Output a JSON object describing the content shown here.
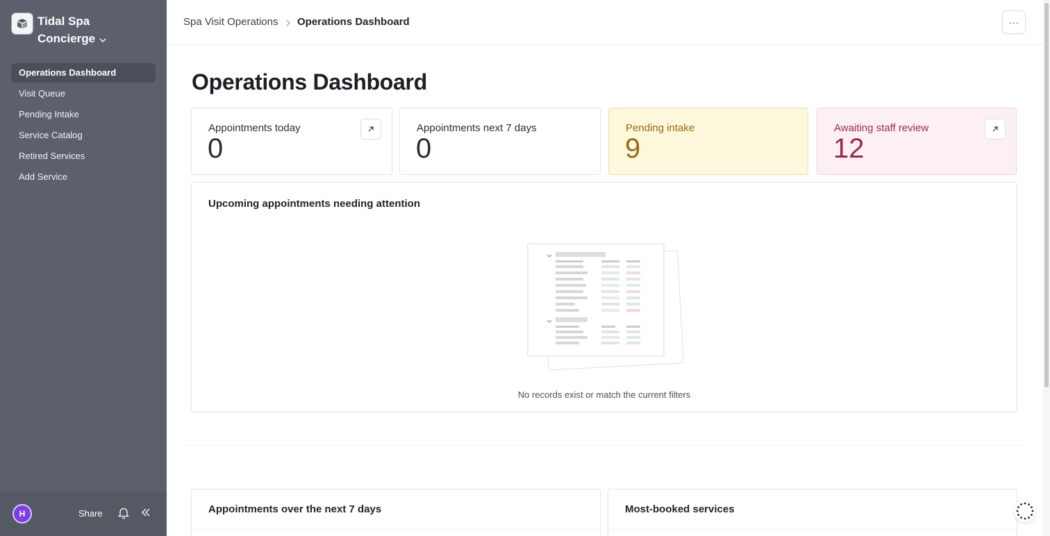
{
  "sidebar": {
    "brand": {
      "line1": "Tidal Spa",
      "line2": "Concierge"
    },
    "items": [
      {
        "label": "Operations Dashboard",
        "active": true
      },
      {
        "label": "Visit Queue"
      },
      {
        "label": "Pending Intake"
      },
      {
        "label": "Service Catalog"
      },
      {
        "label": "Retired Services"
      },
      {
        "label": "Add Service"
      }
    ],
    "footer": {
      "avatar_initial": "H",
      "share_label": "Share",
      "avatar_color": "#7b3fe4"
    }
  },
  "header": {
    "breadcrumb": [
      "Spa Visit Operations",
      "Operations Dashboard"
    ],
    "more_label": "···"
  },
  "main": {
    "title": "Operations Dashboard",
    "cards": [
      {
        "label": "Appointments today",
        "value": "0"
      },
      {
        "label": "Appointments next 7 days",
        "value": "0"
      },
      {
        "label": "Pending intake",
        "value": "9",
        "color": "#9a6a14"
      },
      {
        "label": "Awaiting staff review",
        "value": "12",
        "color": "#9b2a4e"
      }
    ],
    "attention_panel": {
      "title": "Upcoming appointments needing attention",
      "empty_text": "No records exist or match the current filters"
    },
    "bottom_panels": [
      {
        "title": "Appointments over the next 7 days"
      },
      {
        "title": "Most-booked services"
      }
    ]
  }
}
